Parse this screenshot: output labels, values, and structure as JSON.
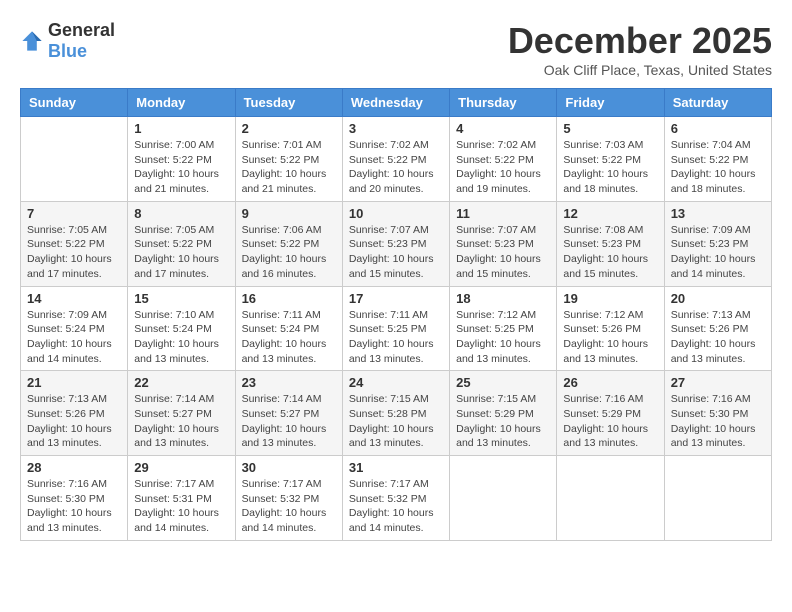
{
  "header": {
    "logo": {
      "general": "General",
      "blue": "Blue"
    },
    "title": "December 2025",
    "location": "Oak Cliff Place, Texas, United States"
  },
  "weekdays": [
    "Sunday",
    "Monday",
    "Tuesday",
    "Wednesday",
    "Thursday",
    "Friday",
    "Saturday"
  ],
  "weeks": [
    [
      {
        "day": "",
        "info": ""
      },
      {
        "day": "1",
        "info": "Sunrise: 7:00 AM\nSunset: 5:22 PM\nDaylight: 10 hours\nand 21 minutes."
      },
      {
        "day": "2",
        "info": "Sunrise: 7:01 AM\nSunset: 5:22 PM\nDaylight: 10 hours\nand 21 minutes."
      },
      {
        "day": "3",
        "info": "Sunrise: 7:02 AM\nSunset: 5:22 PM\nDaylight: 10 hours\nand 20 minutes."
      },
      {
        "day": "4",
        "info": "Sunrise: 7:02 AM\nSunset: 5:22 PM\nDaylight: 10 hours\nand 19 minutes."
      },
      {
        "day": "5",
        "info": "Sunrise: 7:03 AM\nSunset: 5:22 PM\nDaylight: 10 hours\nand 18 minutes."
      },
      {
        "day": "6",
        "info": "Sunrise: 7:04 AM\nSunset: 5:22 PM\nDaylight: 10 hours\nand 18 minutes."
      }
    ],
    [
      {
        "day": "7",
        "info": "Sunrise: 7:05 AM\nSunset: 5:22 PM\nDaylight: 10 hours\nand 17 minutes."
      },
      {
        "day": "8",
        "info": "Sunrise: 7:05 AM\nSunset: 5:22 PM\nDaylight: 10 hours\nand 17 minutes."
      },
      {
        "day": "9",
        "info": "Sunrise: 7:06 AM\nSunset: 5:22 PM\nDaylight: 10 hours\nand 16 minutes."
      },
      {
        "day": "10",
        "info": "Sunrise: 7:07 AM\nSunset: 5:23 PM\nDaylight: 10 hours\nand 15 minutes."
      },
      {
        "day": "11",
        "info": "Sunrise: 7:07 AM\nSunset: 5:23 PM\nDaylight: 10 hours\nand 15 minutes."
      },
      {
        "day": "12",
        "info": "Sunrise: 7:08 AM\nSunset: 5:23 PM\nDaylight: 10 hours\nand 15 minutes."
      },
      {
        "day": "13",
        "info": "Sunrise: 7:09 AM\nSunset: 5:23 PM\nDaylight: 10 hours\nand 14 minutes."
      }
    ],
    [
      {
        "day": "14",
        "info": "Sunrise: 7:09 AM\nSunset: 5:24 PM\nDaylight: 10 hours\nand 14 minutes."
      },
      {
        "day": "15",
        "info": "Sunrise: 7:10 AM\nSunset: 5:24 PM\nDaylight: 10 hours\nand 13 minutes."
      },
      {
        "day": "16",
        "info": "Sunrise: 7:11 AM\nSunset: 5:24 PM\nDaylight: 10 hours\nand 13 minutes."
      },
      {
        "day": "17",
        "info": "Sunrise: 7:11 AM\nSunset: 5:25 PM\nDaylight: 10 hours\nand 13 minutes."
      },
      {
        "day": "18",
        "info": "Sunrise: 7:12 AM\nSunset: 5:25 PM\nDaylight: 10 hours\nand 13 minutes."
      },
      {
        "day": "19",
        "info": "Sunrise: 7:12 AM\nSunset: 5:26 PM\nDaylight: 10 hours\nand 13 minutes."
      },
      {
        "day": "20",
        "info": "Sunrise: 7:13 AM\nSunset: 5:26 PM\nDaylight: 10 hours\nand 13 minutes."
      }
    ],
    [
      {
        "day": "21",
        "info": "Sunrise: 7:13 AM\nSunset: 5:26 PM\nDaylight: 10 hours\nand 13 minutes."
      },
      {
        "day": "22",
        "info": "Sunrise: 7:14 AM\nSunset: 5:27 PM\nDaylight: 10 hours\nand 13 minutes."
      },
      {
        "day": "23",
        "info": "Sunrise: 7:14 AM\nSunset: 5:27 PM\nDaylight: 10 hours\nand 13 minutes."
      },
      {
        "day": "24",
        "info": "Sunrise: 7:15 AM\nSunset: 5:28 PM\nDaylight: 10 hours\nand 13 minutes."
      },
      {
        "day": "25",
        "info": "Sunrise: 7:15 AM\nSunset: 5:29 PM\nDaylight: 10 hours\nand 13 minutes."
      },
      {
        "day": "26",
        "info": "Sunrise: 7:16 AM\nSunset: 5:29 PM\nDaylight: 10 hours\nand 13 minutes."
      },
      {
        "day": "27",
        "info": "Sunrise: 7:16 AM\nSunset: 5:30 PM\nDaylight: 10 hours\nand 13 minutes."
      }
    ],
    [
      {
        "day": "28",
        "info": "Sunrise: 7:16 AM\nSunset: 5:30 PM\nDaylight: 10 hours\nand 13 minutes."
      },
      {
        "day": "29",
        "info": "Sunrise: 7:17 AM\nSunset: 5:31 PM\nDaylight: 10 hours\nand 14 minutes."
      },
      {
        "day": "30",
        "info": "Sunrise: 7:17 AM\nSunset: 5:32 PM\nDaylight: 10 hours\nand 14 minutes."
      },
      {
        "day": "31",
        "info": "Sunrise: 7:17 AM\nSunset: 5:32 PM\nDaylight: 10 hours\nand 14 minutes."
      },
      {
        "day": "",
        "info": ""
      },
      {
        "day": "",
        "info": ""
      },
      {
        "day": "",
        "info": ""
      }
    ]
  ]
}
